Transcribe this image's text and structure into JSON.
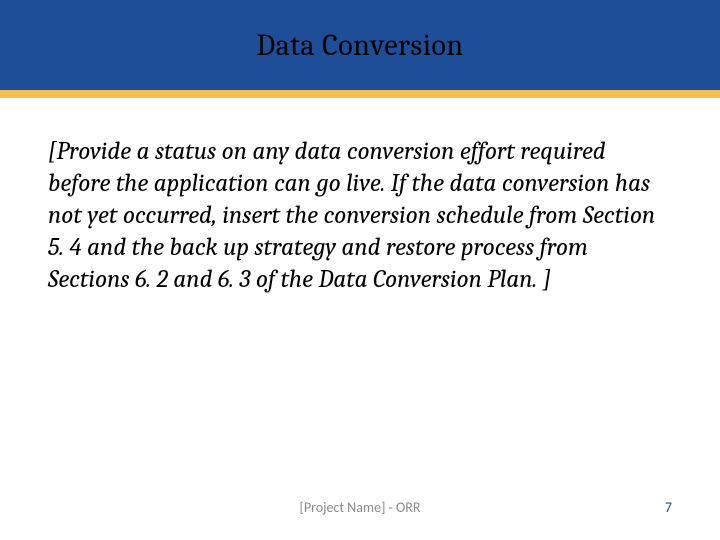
{
  "header": {
    "title": "Data Conversion"
  },
  "body": {
    "paragraph": "[Provide a status on any data conversion effort required before the application can go live. If the data conversion has not yet occurred, insert the conversion schedule from Section 5. 4 and the back up strategy and restore process from Sections 6. 2 and 6. 3 of the Data Conversion Plan. ]"
  },
  "footer": {
    "center": "[Project Name] - ORR",
    "page": "7"
  },
  "colors": {
    "header_bg": "#1f4e98",
    "accent": "#f2c14e",
    "footer_text": "#8a8a8a",
    "page_number": "#1f4e98"
  }
}
